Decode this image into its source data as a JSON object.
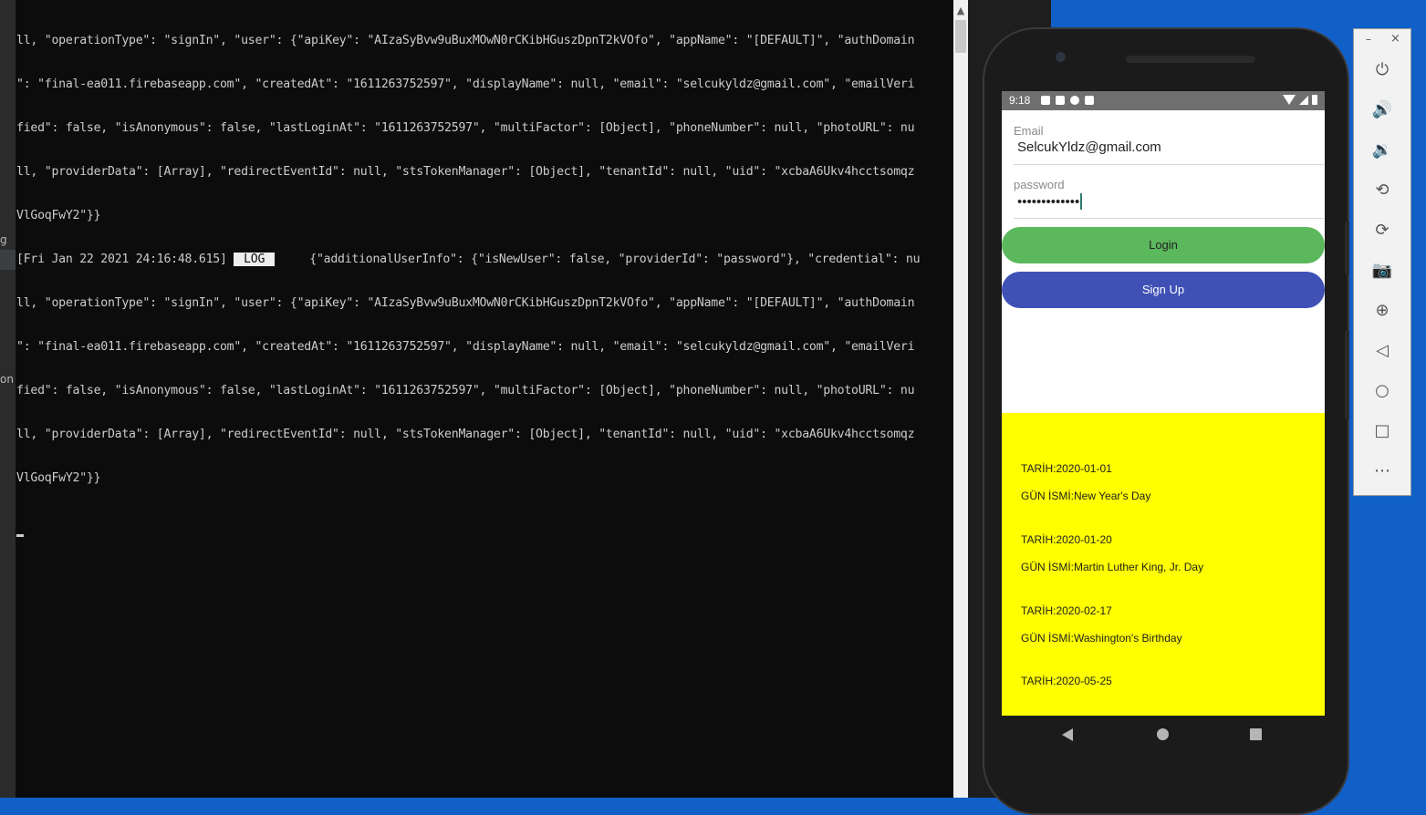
{
  "left_strip": {
    "fragment_1": "g",
    "fragment_2": "on"
  },
  "terminal": {
    "lines": [
      "ll, \"operationType\": \"signIn\", \"user\": {\"apiKey\": \"AIzaSyBvw9uBuxMOwN0rCKibHGuszDpnT2kVOfo\", \"appName\": \"[DEFAULT]\", \"authDomain",
      "\": \"final-ea011.firebaseapp.com\", \"createdAt\": \"1611263752597\", \"displayName\": null, \"email\": \"selcukyldz@gmail.com\", \"emailVeri",
      "fied\": false, \"isAnonymous\": false, \"lastLoginAt\": \"1611263752597\", \"multiFactor\": [Object], \"phoneNumber\": null, \"photoURL\": nu",
      "ll, \"providerData\": [Array], \"redirectEventId\": null, \"stsTokenManager\": [Object], \"tenantId\": null, \"uid\": \"xcbaA6Ukv4hcctsomqz",
      "VlGoqFwY2\"}}"
    ],
    "log_line_prefix": "[Fri Jan 22 2021 24:16:48.615] ",
    "log_badge": " LOG ",
    "log_line_rest": "     {\"additionalUserInfo\": {\"isNewUser\": false, \"providerId\": \"password\"}, \"credential\": nu",
    "lines_2": [
      "ll, \"operationType\": \"signIn\", \"user\": {\"apiKey\": \"AIzaSyBvw9uBuxMOwN0rCKibHGuszDpnT2kVOfo\", \"appName\": \"[DEFAULT]\", \"authDomain",
      "\": \"final-ea011.firebaseapp.com\", \"createdAt\": \"1611263752597\", \"displayName\": null, \"email\": \"selcukyldz@gmail.com\", \"emailVeri",
      "fied\": false, \"isAnonymous\": false, \"lastLoginAt\": \"1611263752597\", \"multiFactor\": [Object], \"phoneNumber\": null, \"photoURL\": nu",
      "ll, \"providerData\": [Array], \"redirectEventId\": null, \"stsTokenManager\": [Object], \"tenantId\": null, \"uid\": \"xcbaA6Ukv4hcctsomqz",
      "VlGoqFwY2\"}}"
    ]
  },
  "phone": {
    "status_time": "9:18",
    "email_label": "Email",
    "email_value": "SelcukYldz@gmail.com",
    "password_label": "password",
    "password_value": "•••••••••••••",
    "login_label": "Login",
    "signup_label": "Sign Up",
    "holidays": [
      {
        "date": "TARİH:2020-01-01",
        "name": "GÜN İSMİ:New Year's Day"
      },
      {
        "date": "TARİH:2020-01-20",
        "name": "GÜN İSMİ:Martin Luther King, Jr. Day"
      },
      {
        "date": "TARİH:2020-02-17",
        "name": "GÜN İSMİ:Washington's Birthday"
      },
      {
        "date": "TARİH:2020-05-25",
        "name": ""
      }
    ]
  },
  "emulator_toolbar": {
    "minimize": "–",
    "close": "×",
    "buttons": [
      {
        "icon": "power-icon",
        "glyph": "⏻"
      },
      {
        "icon": "volume-up-icon",
        "glyph": "🔊"
      },
      {
        "icon": "volume-down-icon",
        "glyph": "🔉"
      },
      {
        "icon": "rotate-left-icon",
        "glyph": "⟲"
      },
      {
        "icon": "rotate-right-icon",
        "glyph": "⟳"
      },
      {
        "icon": "camera-icon",
        "glyph": "📷"
      },
      {
        "icon": "zoom-icon",
        "glyph": "⊕"
      },
      {
        "icon": "back-icon",
        "glyph": "◁"
      },
      {
        "icon": "home-icon",
        "glyph": "○"
      },
      {
        "icon": "overview-icon",
        "glyph": "□"
      },
      {
        "icon": "more-icon",
        "glyph": "⋯"
      }
    ]
  },
  "colors": {
    "desktop": "#1160c8",
    "terminal_bg": "#0c0c0c",
    "login_button": "#5cb85c",
    "signup_button": "#3f51b5",
    "holiday_bg": "#ffff00"
  }
}
